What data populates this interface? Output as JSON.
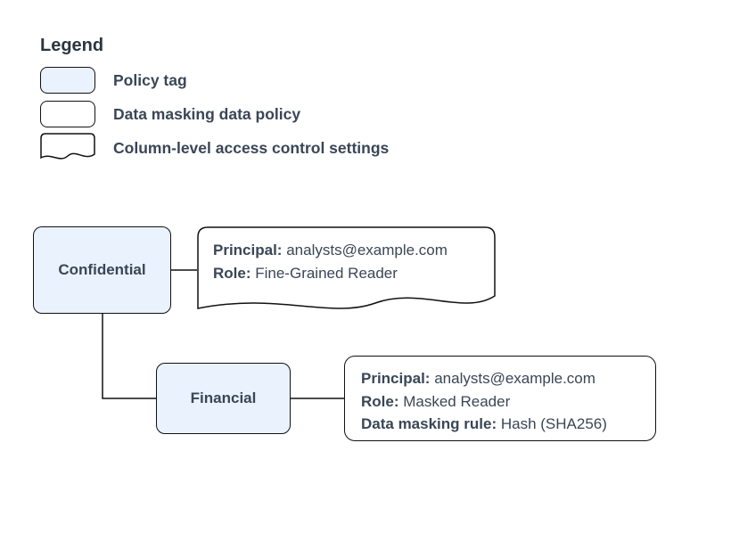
{
  "legend": {
    "title": "Legend",
    "policy_tag": "Policy tag",
    "data_masking": "Data masking data policy",
    "column_level": "Column-level access control settings"
  },
  "nodes": {
    "confidential": {
      "label": "Confidential",
      "access": {
        "principal_label": "Principal:",
        "principal_value": "analysts@example.com",
        "role_label": "Role:",
        "role_value": "Fine-Grained Reader"
      }
    },
    "financial": {
      "label": "Financial",
      "policy": {
        "principal_label": "Principal:",
        "principal_value": "analysts@example.com",
        "role_label": "Role:",
        "role_value": "Masked Reader",
        "mask_label": "Data masking rule:",
        "mask_value": "Hash (SHA256)"
      }
    }
  }
}
